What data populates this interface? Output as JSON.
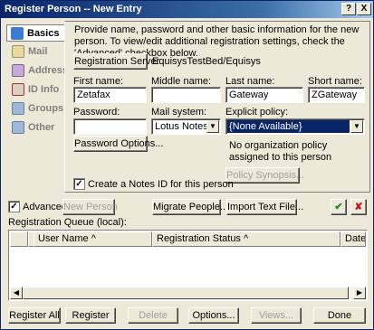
{
  "window": {
    "title": "Register Person -- New Entry",
    "help_glyph": "?",
    "close_glyph": "X"
  },
  "tabs": [
    {
      "label": "Basics",
      "icon": "person-icon",
      "color": "#3C7BD0"
    },
    {
      "label": "Mail",
      "icon": "mail-icon",
      "color": "#C8B070"
    },
    {
      "label": "Address",
      "icon": "address-icon",
      "color": "#A070B0"
    },
    {
      "label": "ID Info",
      "icon": "id-info-icon",
      "color": "#B03030"
    },
    {
      "label": "Groups",
      "icon": "groups-icon",
      "color": "#7090C0"
    },
    {
      "label": "Other",
      "icon": "other-icon",
      "color": "#7090C0"
    }
  ],
  "basics": {
    "intro": "Provide name, password and other basic information for the new person.  To view/edit additional registration settings, check the 'Advanced' checkbox below.",
    "registration_server_button": "Registration Server...",
    "registration_server_value": "EquisysTestBed/Equisys",
    "first_name_label": "First name:",
    "first_name_value": "Zetafax",
    "middle_name_label": "Middle name:",
    "middle_name_value": "",
    "last_name_label": "Last name:",
    "last_name_value": "Gateway",
    "short_name_label": "Short name:",
    "short_name_value": "ZGateway",
    "password_label": "Password:",
    "password_value": "",
    "mail_system_label": "Mail system:",
    "mail_system_value": "Lotus Notes",
    "explicit_policy_label": "Explicit policy:",
    "explicit_policy_value": "{None Available}",
    "password_options_button": "Password Options...",
    "policy_note": "No organization policy assigned to this person",
    "policy_synopsis_button": "Policy Synopsis...",
    "create_notes_id_label": "Create a Notes ID for this person",
    "create_notes_id_checked": true,
    "selection_color": "#0A246A"
  },
  "advanced_row": {
    "advanced_label": "Advanced",
    "advanced_checked": true,
    "new_person_button": "New Person",
    "migrate_people_button": "Migrate People...",
    "import_text_file_button": "Import Text File...",
    "accept_glyph": "✔",
    "reject_glyph": "✘"
  },
  "queue": {
    "label": "Registration Queue (local):",
    "columns": [
      "User Name",
      "Registration Status",
      "Date"
    ]
  },
  "bottom_buttons": {
    "register_all": "Register All",
    "register": "Register",
    "delete": "Delete",
    "options": "Options...",
    "views": "Views...",
    "done": "Done"
  }
}
